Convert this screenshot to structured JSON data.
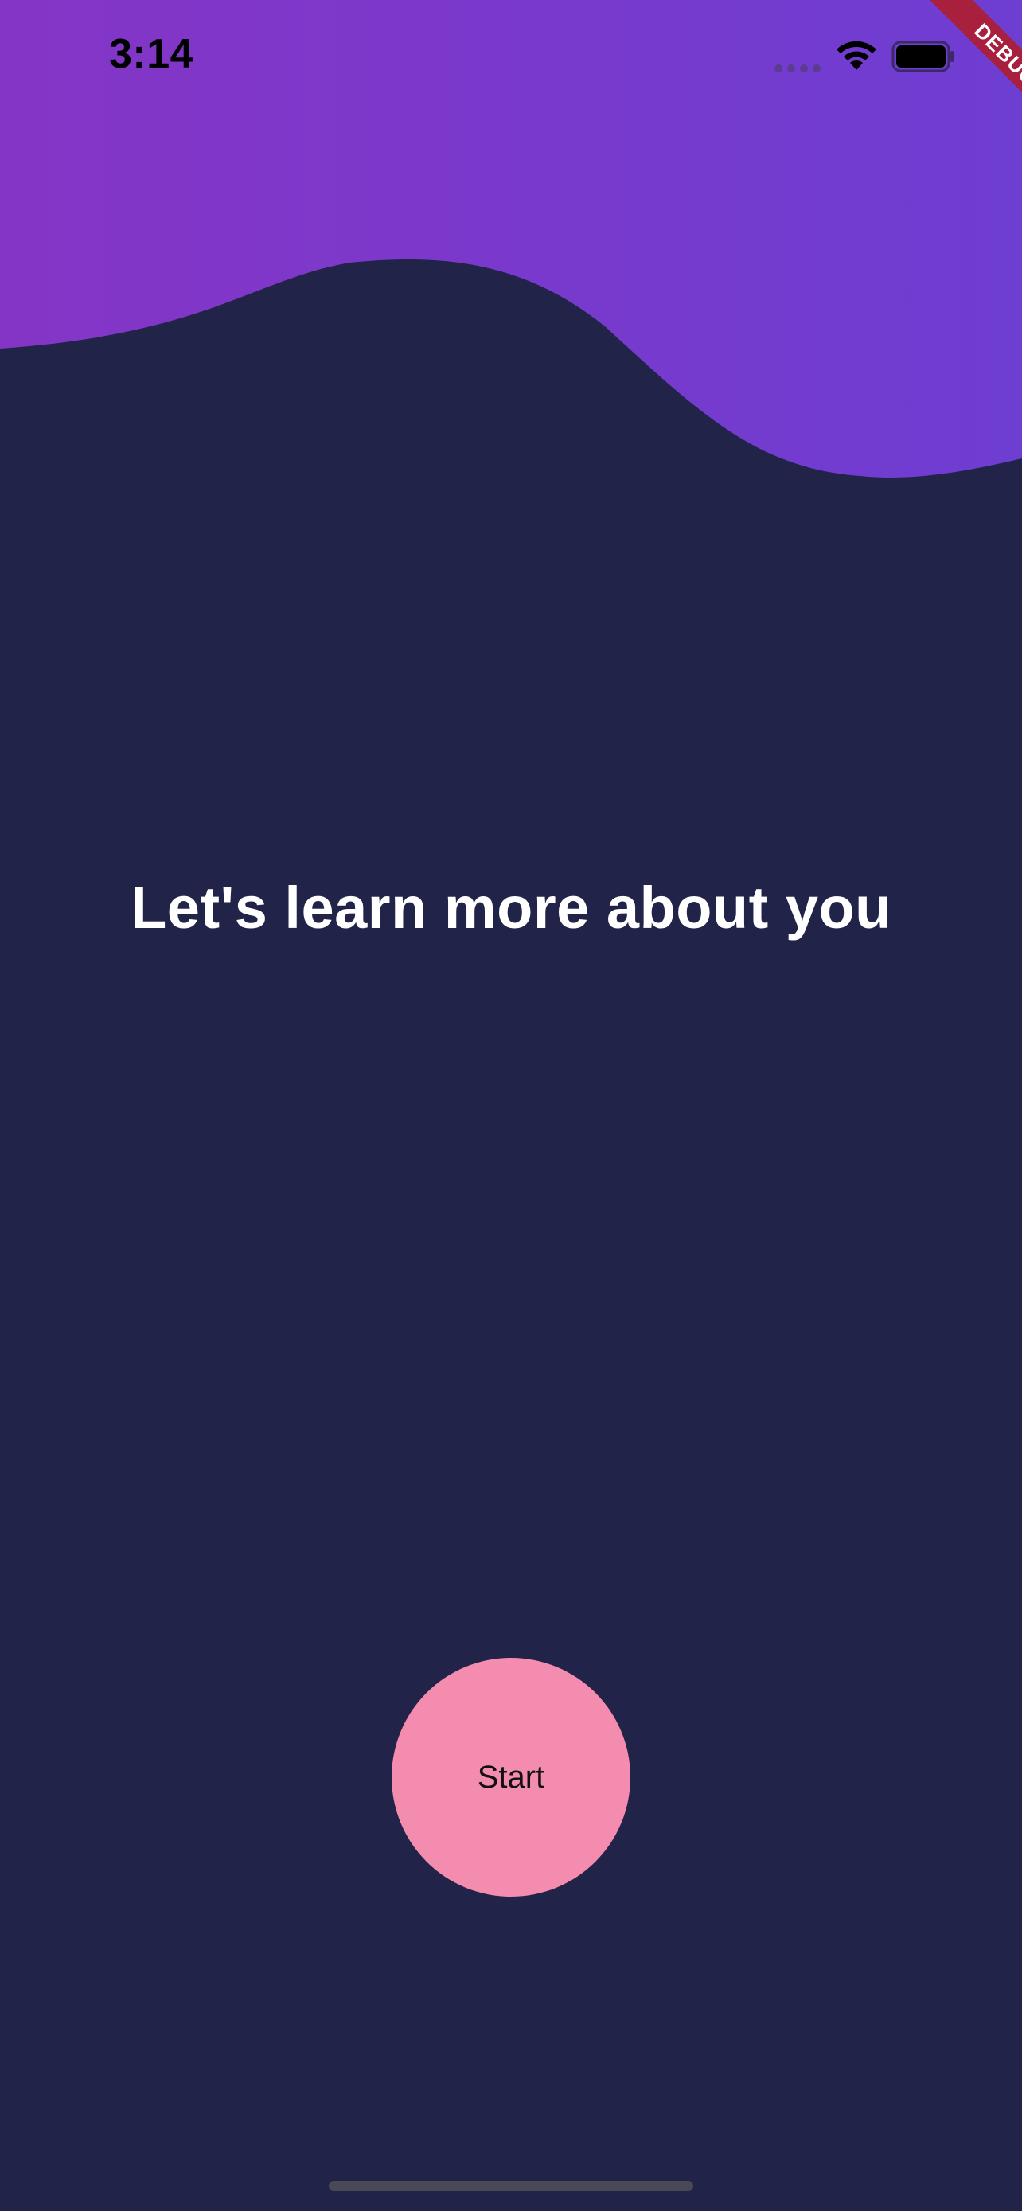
{
  "status_bar": {
    "time": "3:14",
    "icons": [
      "signal-dots-icon",
      "wifi-icon",
      "battery-icon"
    ]
  },
  "debug_banner": {
    "label": "DEBUG",
    "color": "#A8203E"
  },
  "onboarding": {
    "headline": "Let's learn more about you",
    "start_label": "Start"
  },
  "colors": {
    "background": "#212448",
    "wave_gradient_start": "#8535C6",
    "wave_gradient_end": "#6E3DD2",
    "start_button": "#F48CB0",
    "headline_text": "#FFFFFF"
  }
}
